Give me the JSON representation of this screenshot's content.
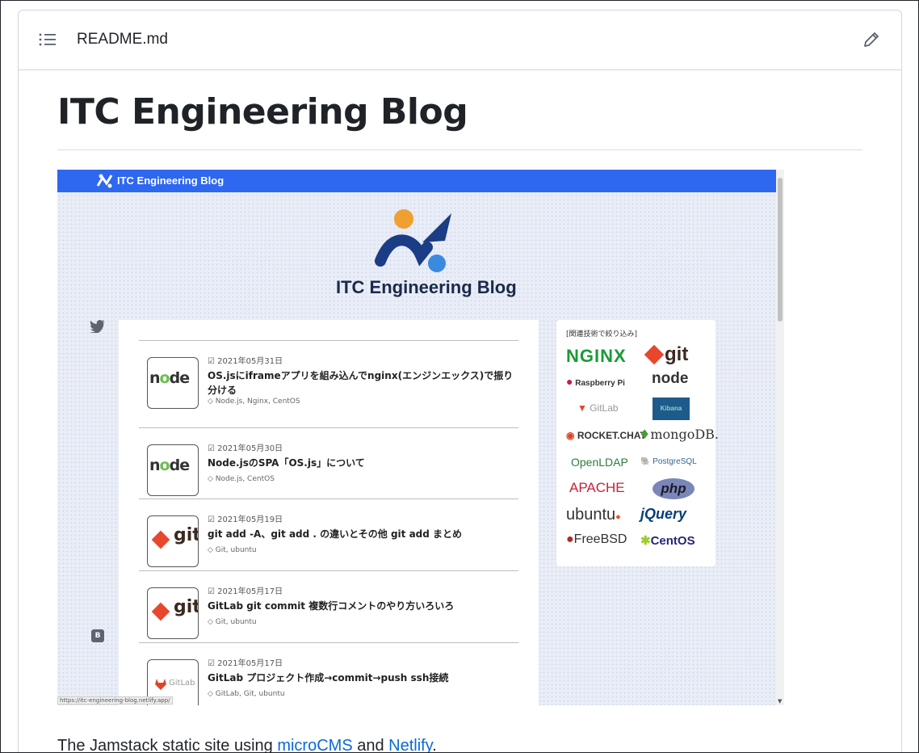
{
  "file": {
    "name": "README.md"
  },
  "readme": {
    "heading": "ITC Engineering Blog",
    "intro": {
      "text_before": "The Jamstack static site using ",
      "link1": "microCMS",
      "text_middle": " and ",
      "link2": "Netlify",
      "text_after": "."
    }
  },
  "screenshot": {
    "topbar_title": "ITC Engineering Blog",
    "hero_title": "ITC Engineering Blog",
    "status_url": "https://itc-engineering-blog.netlify.app/",
    "posts": [
      {
        "date": "2021年05月31日",
        "title": "OS.jsにiframeアプリを組み込んでnginx(エンジンエックス)で振り分ける",
        "tags": "Node.js, Nginx, CentOS",
        "thumb": "node"
      },
      {
        "date": "2021年05月30日",
        "title": "Node.jsのSPA「OS.js」について",
        "tags": "Node.js, CentOS",
        "thumb": "node"
      },
      {
        "date": "2021年05月19日",
        "title": "git add -A、git add . の違いとその他 git add まとめ",
        "tags": "Git, ubuntu",
        "thumb": "git"
      },
      {
        "date": "2021年05月17日",
        "title": "GitLab git commit 複数行コメントのやり方いろいろ",
        "tags": "Git, ubuntu",
        "thumb": "git"
      },
      {
        "date": "2021年05月17日",
        "title": "GitLab プロジェクト作成→commit→push ssh接続",
        "tags": "GitLab, Git, ubuntu",
        "thumb": "gitlab"
      }
    ],
    "tech_filter": {
      "heading": "[関連技術で絞り込み]",
      "items": [
        "NGINX",
        "git",
        "Raspberry Pi",
        "node",
        "GitLab",
        "Kibana",
        "ROCKET.CHAT",
        "mongoDB.",
        "OpenLDAP",
        "PostgreSQL",
        "APACHE",
        "php",
        "ubuntu",
        "jQuery",
        "FreeBSD",
        "CentOS"
      ]
    }
  },
  "icons": [
    "list-icon",
    "pencil-icon",
    "twitter-icon",
    "tag-icon",
    "edit-date-icon"
  ],
  "colors": {
    "link": "#0969da",
    "topbar": "#2e67f0",
    "text": "#1f2328",
    "border": "#d0d7de"
  }
}
